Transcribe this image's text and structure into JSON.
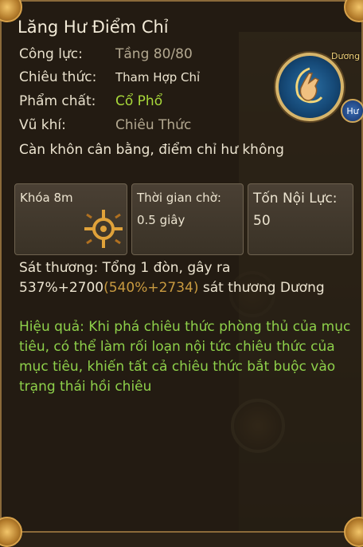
{
  "skill": {
    "name": "Lăng Hư Điểm Chỉ",
    "element_tag": "Dương",
    "type_badge": "Hư",
    "rows": [
      {
        "label": "Công lực:",
        "value": "Tầng 80/80"
      },
      {
        "label": "Chiêu thức:",
        "value": "Tham Hợp Chỉ"
      },
      {
        "label": "Phẩm chất:",
        "value": "Cổ Phổ"
      },
      {
        "label": "Vũ khí:",
        "value": "Chiêu Thức"
      }
    ],
    "description": "Càn khôn cân bằng, điểm chỉ hư không",
    "stats": [
      {
        "label": "Khóa 8m",
        "value": "",
        "icon": "lock-crosshair-icon"
      },
      {
        "label": "Thời gian chờ:",
        "value": "0.5 giây"
      },
      {
        "label": "Tốn Nội Lực:",
        "value": "50"
      }
    ],
    "damage": {
      "prefix": "Sát thương: Tổng 1 đòn, gây ra 537%+2700",
      "extra": "(540%+2734)",
      "suffix": " sát thương Dương"
    },
    "effect": "Hiệu quả: Khi phá chiêu thức phòng thủ của mục tiêu, có thể làm rối loạn nội tức chiêu thức của mục tiêu, khiến tất cả chiêu thức bắt buộc vào trạng thái hồi chiêu"
  },
  "colors": {
    "quality": "#a8d83a",
    "effect_text": "#8ed04a",
    "damage_extra": "#c89a40",
    "frame": "#8b6a3a"
  }
}
